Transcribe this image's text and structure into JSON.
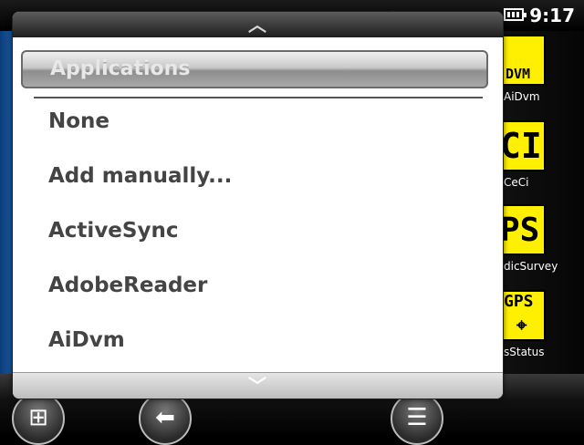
{
  "status_bar": {
    "time": "9:17",
    "icons": [
      "sync-icon",
      "signal-icon",
      "close-icon",
      "battery-icon"
    ]
  },
  "desktop": {
    "apps": [
      {
        "label": "AiDvm",
        "tile_text": "DVM"
      },
      {
        "label": "CeCi",
        "tile_text": "CI"
      },
      {
        "label": "dicSurvey",
        "tile_text": "PS"
      },
      {
        "label": "sStatus",
        "tile_text": "GPS"
      }
    ]
  },
  "picker": {
    "header": "Applications",
    "items": [
      "None",
      "Add manually...",
      "ActiveSync",
      "AdobeReader",
      "AiDvm"
    ],
    "scroll_up_icon": "chevron-up-icon",
    "scroll_down_icon": "chevron-down-icon"
  },
  "taskbar": {
    "buttons": [
      "windows-start-icon",
      "back-arrow-icon",
      "menu-icon"
    ]
  }
}
